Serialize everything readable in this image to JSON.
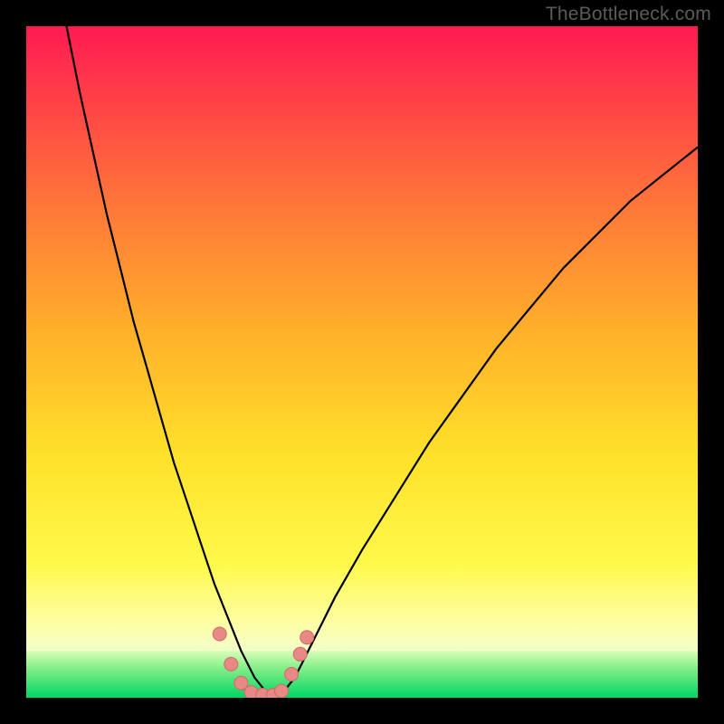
{
  "watermark": "TheBottleneck.com",
  "colors": {
    "frame": "#000000",
    "curve": "#000000",
    "marker_fill": "#e78a86",
    "marker_stroke": "#d16862",
    "green_top": "#c9f7b0",
    "green_bottom": "#00d562",
    "grad_top": "#ff1a52",
    "grad_mid_upper": "#ff8a2e",
    "grad_mid": "#ffd32a",
    "grad_mid_lower": "#fff22a",
    "grad_lower": "#fcff9a"
  },
  "chart_data": {
    "type": "line",
    "title": "",
    "xlabel": "",
    "ylabel": "",
    "xlim": [
      0,
      100
    ],
    "ylim": [
      0,
      100
    ],
    "note": "x and y are in percent of plot area; y=0 at top, y=100 at bottom (visual coords). The curve is a V-shaped valley bottoming near x≈34, y≈100 and rising steeply on both sides.",
    "series": [
      {
        "name": "valley-curve",
        "x": [
          6,
          8,
          10,
          12,
          14,
          16,
          18,
          20,
          22,
          24,
          26,
          28,
          30,
          32,
          34,
          36,
          38,
          40,
          42,
          44,
          46,
          50,
          55,
          60,
          65,
          70,
          75,
          80,
          85,
          90,
          95,
          100
        ],
        "y": [
          0,
          10,
          19,
          28,
          36,
          44,
          51,
          58,
          65,
          71,
          77,
          83,
          88,
          93,
          97,
          99.5,
          99.5,
          97,
          93,
          89,
          85,
          78,
          70,
          62,
          55,
          48,
          42,
          36,
          31,
          26,
          22,
          18
        ]
      }
    ],
    "markers": {
      "name": "valley-floor-points",
      "x": [
        28.8,
        30.5,
        32.0,
        33.5,
        35.2,
        36.8,
        38.0,
        39.5,
        40.8,
        41.8
      ],
      "y": [
        90.5,
        95.0,
        97.8,
        99.2,
        99.6,
        99.6,
        99.0,
        96.5,
        93.5,
        91.0
      ]
    },
    "green_band_y": [
      93,
      100
    ]
  }
}
